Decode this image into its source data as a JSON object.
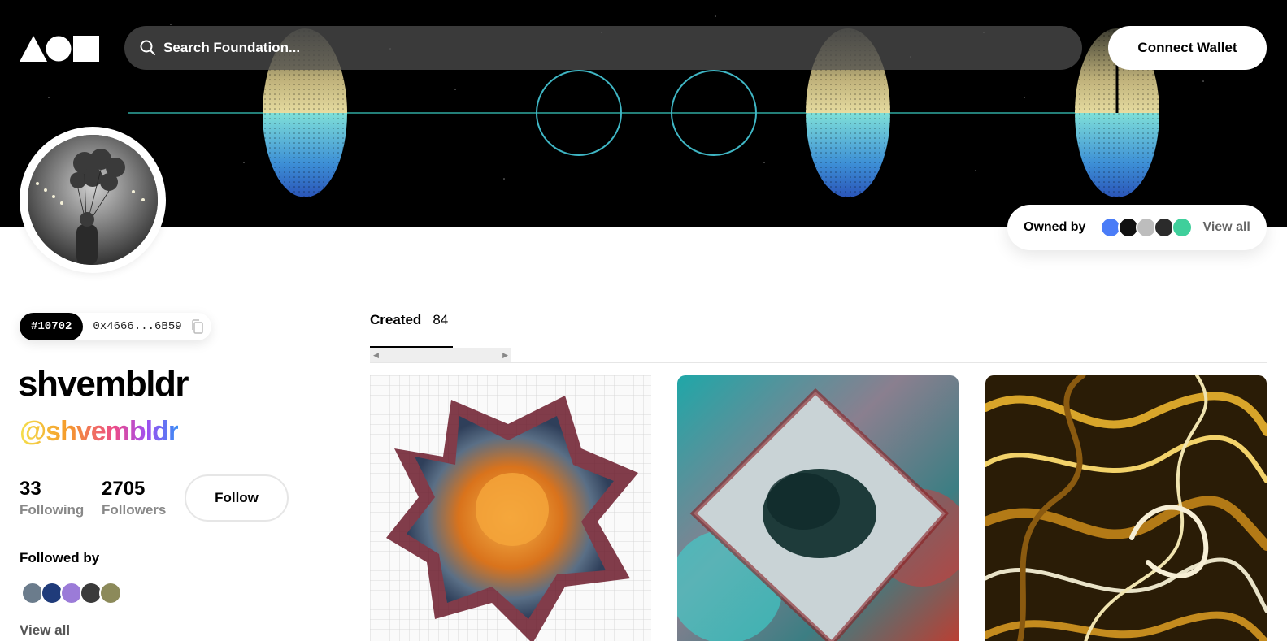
{
  "header": {
    "search_placeholder": "Search Foundation...",
    "connect_wallet_label": "Connect Wallet"
  },
  "owned_by": {
    "label": "Owned by",
    "view_all_label": "View all",
    "avatar_colors": [
      "#4a7cf7",
      "#111111",
      "#bdbdbd",
      "#2b2b2b",
      "#3fcf9b"
    ]
  },
  "profile": {
    "id": "#10702",
    "address": "0x4666...6B59",
    "username": "shvembldr",
    "handle": "@shvembldr",
    "following_count": "33",
    "following_label": "Following",
    "followers_count": "2705",
    "followers_label": "Followers",
    "follow_label": "Follow",
    "followed_by_label": "Followed by",
    "followed_by_colors": [
      "#6b7c8c",
      "#1f3b7a",
      "#9b7bd8",
      "#3a3a3a",
      "#8c8a5a"
    ],
    "view_all_label": "View all"
  },
  "tabs": [
    {
      "label": "Created",
      "count": "84",
      "active": true
    }
  ],
  "colors": {
    "accent": "#000000",
    "banner_bg": "#000000"
  }
}
